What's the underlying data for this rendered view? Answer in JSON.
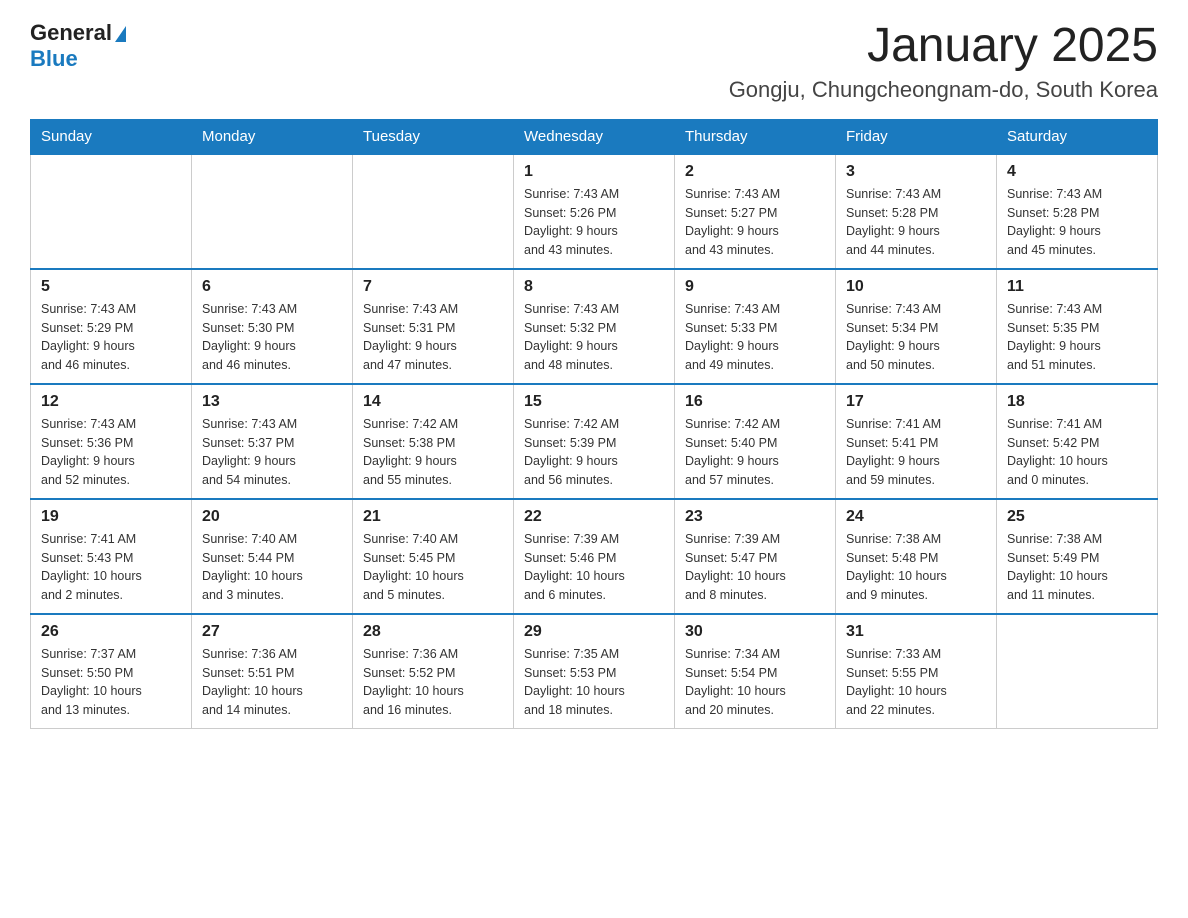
{
  "logo": {
    "general": "General",
    "blue": "Blue"
  },
  "title": "January 2025",
  "subtitle": "Gongju, Chungcheongnam-do, South Korea",
  "weekdays": [
    "Sunday",
    "Monday",
    "Tuesday",
    "Wednesday",
    "Thursday",
    "Friday",
    "Saturday"
  ],
  "weeks": [
    [
      {
        "day": "",
        "info": ""
      },
      {
        "day": "",
        "info": ""
      },
      {
        "day": "",
        "info": ""
      },
      {
        "day": "1",
        "info": "Sunrise: 7:43 AM\nSunset: 5:26 PM\nDaylight: 9 hours\nand 43 minutes."
      },
      {
        "day": "2",
        "info": "Sunrise: 7:43 AM\nSunset: 5:27 PM\nDaylight: 9 hours\nand 43 minutes."
      },
      {
        "day": "3",
        "info": "Sunrise: 7:43 AM\nSunset: 5:28 PM\nDaylight: 9 hours\nand 44 minutes."
      },
      {
        "day": "4",
        "info": "Sunrise: 7:43 AM\nSunset: 5:28 PM\nDaylight: 9 hours\nand 45 minutes."
      }
    ],
    [
      {
        "day": "5",
        "info": "Sunrise: 7:43 AM\nSunset: 5:29 PM\nDaylight: 9 hours\nand 46 minutes."
      },
      {
        "day": "6",
        "info": "Sunrise: 7:43 AM\nSunset: 5:30 PM\nDaylight: 9 hours\nand 46 minutes."
      },
      {
        "day": "7",
        "info": "Sunrise: 7:43 AM\nSunset: 5:31 PM\nDaylight: 9 hours\nand 47 minutes."
      },
      {
        "day": "8",
        "info": "Sunrise: 7:43 AM\nSunset: 5:32 PM\nDaylight: 9 hours\nand 48 minutes."
      },
      {
        "day": "9",
        "info": "Sunrise: 7:43 AM\nSunset: 5:33 PM\nDaylight: 9 hours\nand 49 minutes."
      },
      {
        "day": "10",
        "info": "Sunrise: 7:43 AM\nSunset: 5:34 PM\nDaylight: 9 hours\nand 50 minutes."
      },
      {
        "day": "11",
        "info": "Sunrise: 7:43 AM\nSunset: 5:35 PM\nDaylight: 9 hours\nand 51 minutes."
      }
    ],
    [
      {
        "day": "12",
        "info": "Sunrise: 7:43 AM\nSunset: 5:36 PM\nDaylight: 9 hours\nand 52 minutes."
      },
      {
        "day": "13",
        "info": "Sunrise: 7:43 AM\nSunset: 5:37 PM\nDaylight: 9 hours\nand 54 minutes."
      },
      {
        "day": "14",
        "info": "Sunrise: 7:42 AM\nSunset: 5:38 PM\nDaylight: 9 hours\nand 55 minutes."
      },
      {
        "day": "15",
        "info": "Sunrise: 7:42 AM\nSunset: 5:39 PM\nDaylight: 9 hours\nand 56 minutes."
      },
      {
        "day": "16",
        "info": "Sunrise: 7:42 AM\nSunset: 5:40 PM\nDaylight: 9 hours\nand 57 minutes."
      },
      {
        "day": "17",
        "info": "Sunrise: 7:41 AM\nSunset: 5:41 PM\nDaylight: 9 hours\nand 59 minutes."
      },
      {
        "day": "18",
        "info": "Sunrise: 7:41 AM\nSunset: 5:42 PM\nDaylight: 10 hours\nand 0 minutes."
      }
    ],
    [
      {
        "day": "19",
        "info": "Sunrise: 7:41 AM\nSunset: 5:43 PM\nDaylight: 10 hours\nand 2 minutes."
      },
      {
        "day": "20",
        "info": "Sunrise: 7:40 AM\nSunset: 5:44 PM\nDaylight: 10 hours\nand 3 minutes."
      },
      {
        "day": "21",
        "info": "Sunrise: 7:40 AM\nSunset: 5:45 PM\nDaylight: 10 hours\nand 5 minutes."
      },
      {
        "day": "22",
        "info": "Sunrise: 7:39 AM\nSunset: 5:46 PM\nDaylight: 10 hours\nand 6 minutes."
      },
      {
        "day": "23",
        "info": "Sunrise: 7:39 AM\nSunset: 5:47 PM\nDaylight: 10 hours\nand 8 minutes."
      },
      {
        "day": "24",
        "info": "Sunrise: 7:38 AM\nSunset: 5:48 PM\nDaylight: 10 hours\nand 9 minutes."
      },
      {
        "day": "25",
        "info": "Sunrise: 7:38 AM\nSunset: 5:49 PM\nDaylight: 10 hours\nand 11 minutes."
      }
    ],
    [
      {
        "day": "26",
        "info": "Sunrise: 7:37 AM\nSunset: 5:50 PM\nDaylight: 10 hours\nand 13 minutes."
      },
      {
        "day": "27",
        "info": "Sunrise: 7:36 AM\nSunset: 5:51 PM\nDaylight: 10 hours\nand 14 minutes."
      },
      {
        "day": "28",
        "info": "Sunrise: 7:36 AM\nSunset: 5:52 PM\nDaylight: 10 hours\nand 16 minutes."
      },
      {
        "day": "29",
        "info": "Sunrise: 7:35 AM\nSunset: 5:53 PM\nDaylight: 10 hours\nand 18 minutes."
      },
      {
        "day": "30",
        "info": "Sunrise: 7:34 AM\nSunset: 5:54 PM\nDaylight: 10 hours\nand 20 minutes."
      },
      {
        "day": "31",
        "info": "Sunrise: 7:33 AM\nSunset: 5:55 PM\nDaylight: 10 hours\nand 22 minutes."
      },
      {
        "day": "",
        "info": ""
      }
    ]
  ]
}
